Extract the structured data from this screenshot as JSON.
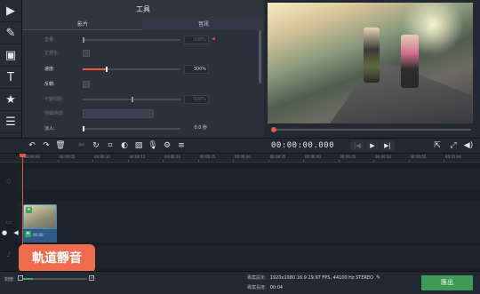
{
  "panel": {
    "title": "工具",
    "tabs": [
      "影片",
      "音訊"
    ],
    "properties": [
      {
        "label": "音量:",
        "value": "100%",
        "enabled": false
      },
      {
        "label": "正規化:",
        "enabled": false
      },
      {
        "label": "速度:",
        "value": "300%",
        "enabled": true
      },
      {
        "label": "反轉:",
        "enabled": true
      },
      {
        "label": "不變間距:",
        "value": "100%",
        "enabled": false
      },
      {
        "label": "持續時間:",
        "value": "",
        "enabled": false
      },
      {
        "label": "淡入:",
        "value": "0.0 秒",
        "enabled": true
      }
    ]
  },
  "player": {
    "timecode": "00:00:00.000",
    "progress": 0.0
  },
  "timeline": {
    "ruler_ticks": [
      "00:00:00",
      "00:00:05",
      "00:00:10",
      "00:00:15",
      "00:00:20",
      "00:00:25",
      "00:00:30",
      "00:00:35",
      "00:00:40",
      "00:00:45",
      "00:00:50",
      "00:00:55",
      "00:01:00"
    ],
    "clip_caption": "00:00"
  },
  "tooltip": {
    "text": "軌道靜音"
  },
  "footer": {
    "zoom_label": "刻度:",
    "zoom_level": 0.15,
    "settings_label": "專案設定:",
    "settings_value": "1920x1080 16:9 29.97 FPS, 44100 Hz STEREO",
    "length_label": "專案長度:",
    "length_value": "00:04",
    "export_label": "匯出"
  },
  "icons": [
    "import-icon",
    "magic-wand-icon",
    "filmstrip-icon",
    "title-icon",
    "sticker-icon",
    "menu-icon",
    "undo-icon",
    "redo-icon",
    "delete-icon",
    "cut-icon",
    "rotate-icon",
    "crop-icon",
    "color-icon",
    "image-icon",
    "mic-icon",
    "settings-icon",
    "equalizer-icon"
  ],
  "colors": {
    "accent": "#e05b3e",
    "export": "#3d9a57",
    "clip_border": "#3e8acb"
  }
}
